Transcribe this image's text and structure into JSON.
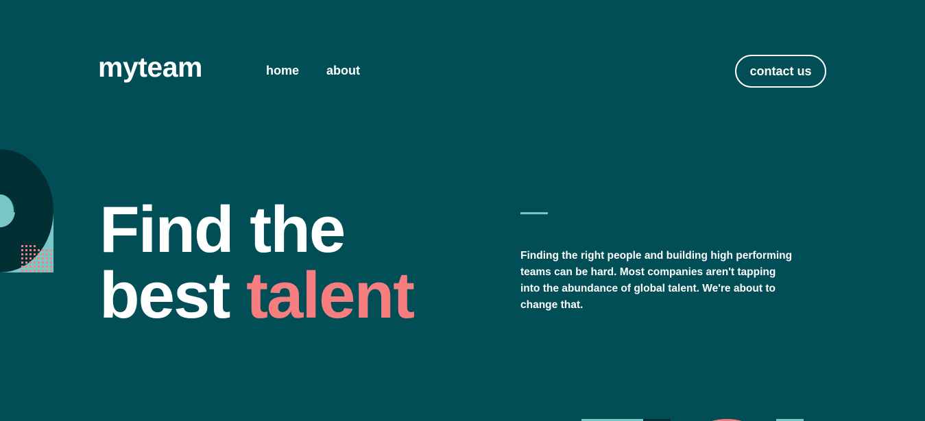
{
  "header": {
    "logo": "myteam",
    "nav": [
      {
        "label": "home"
      },
      {
        "label": "about"
      }
    ],
    "contact_label": "contact us"
  },
  "hero": {
    "heading_line1": "Find the",
    "heading_line2_plain": "best ",
    "heading_line2_accent": "talent",
    "description": "Finding the right people and building high performing teams can be hard. Most companies aren't tapping into the abundance of global talent. We're about to change that."
  },
  "colors": {
    "background": "#014E56",
    "accent_coral": "#F67E7E",
    "accent_teal": "#79C8C7",
    "dark_teal": "#012F34",
    "text": "#FFFFFF"
  },
  "icons": {
    "left_decoration": "semicircle-ring-shape",
    "bottom_decoration": "shapes-fragment"
  }
}
